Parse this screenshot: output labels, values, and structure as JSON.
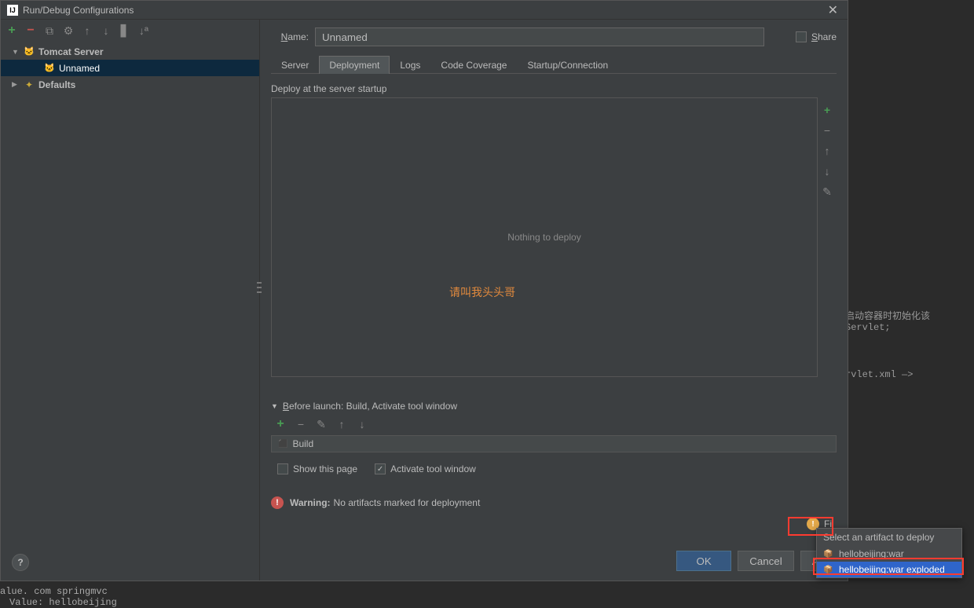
{
  "dialog": {
    "title": "Run/Debug Configurations"
  },
  "tree": {
    "tomcat_server": "Tomcat Server",
    "unnamed": "Unnamed",
    "defaults": "Defaults"
  },
  "name": {
    "label": "Name:",
    "value": "Unnamed"
  },
  "share_label": "Share",
  "tabs": {
    "server": "Server",
    "deployment": "Deployment",
    "logs": "Logs",
    "coverage": "Code Coverage",
    "startup": "Startup/Connection"
  },
  "deploy": {
    "section_label": "Deploy at the server startup",
    "empty_text": "Nothing to deploy"
  },
  "before_launch": {
    "header": "Before launch: Build, Activate tool window",
    "item": "Build"
  },
  "options": {
    "show_page": "Show this page",
    "activate_window": "Activate tool window"
  },
  "warning": {
    "label": "Warning:",
    "text": "No artifacts marked for deployment"
  },
  "fix": {
    "label": "Fi"
  },
  "buttons": {
    "ok": "OK",
    "cancel": "Cancel",
    "apply": "Ap"
  },
  "popup": {
    "title": "Select an artifact to deploy",
    "items": [
      "hellobeijing:war",
      "hellobeijing:war exploded"
    ]
  },
  "watermark": "请叫我头头哥",
  "bg": {
    "line1": "启动容器时初始化该Servlet;",
    "line2": "rvlet.xml —>",
    "line3": "alue. com springmvc",
    "line4": "Value: hellobeijing"
  }
}
